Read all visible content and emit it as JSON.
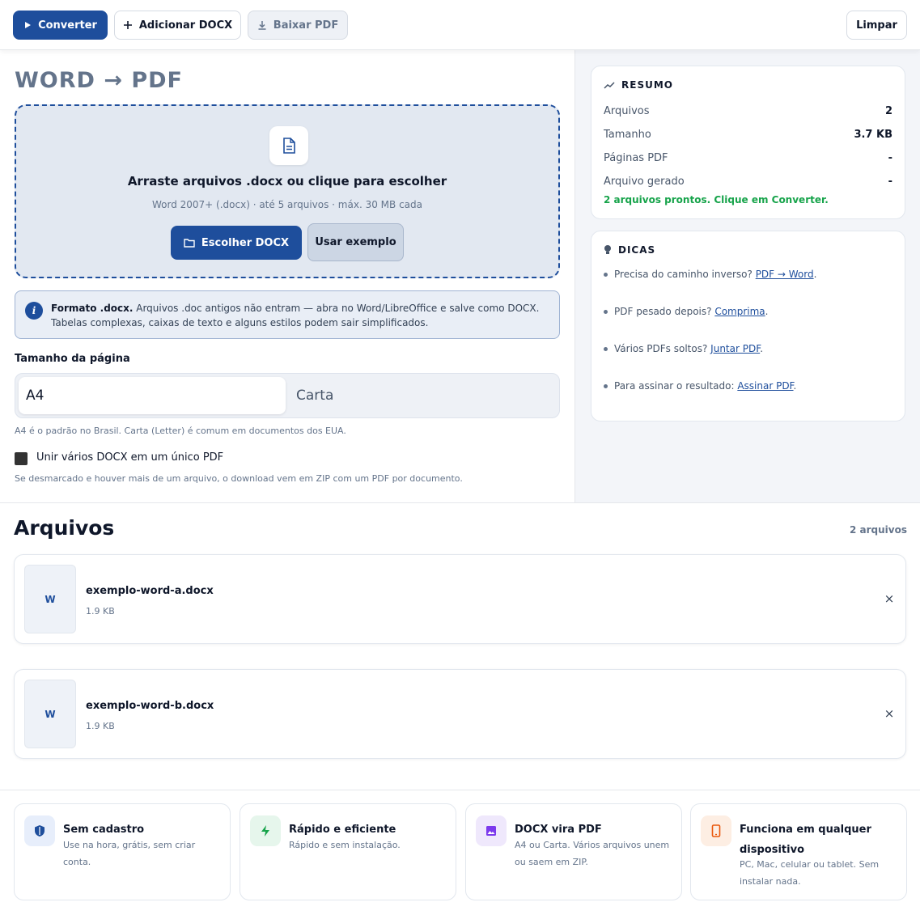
{
  "toolbar": {
    "convert_label": "Converter",
    "add_label": "Adicionar DOCX",
    "download_label": "Baixar PDF",
    "clear_label": "Limpar"
  },
  "page_title": "WORD → PDF",
  "dropzone": {
    "title": "Arraste arquivos .docx ou clique para escolher",
    "subtitle": "Word 2007+ (.docx) · até 5 arquivos · máx. 30 MB cada",
    "choose_label": "Escolher DOCX",
    "example_label": "Usar exemplo"
  },
  "info": {
    "bold": "Formato .docx.",
    "text": " Arquivos .doc antigos não entram — abra no Word/LibreOffice e salve como DOCX. Tabelas complexas, caixas de texto e alguns estilos podem sair simplificados."
  },
  "page_size": {
    "label": "Tamanho da página",
    "options": [
      "A4",
      "Carta"
    ],
    "selected": "A4",
    "hint": "A4 é o padrão no Brasil. Carta (Letter) é comum em documentos dos EUA."
  },
  "merge": {
    "label": "Unir vários DOCX em um único PDF",
    "checked": true,
    "hint": "Se desmarcado e houver mais de um arquivo, o download vem em ZIP com um PDF por documento."
  },
  "resumo": {
    "heading": "RESUMO",
    "rows": [
      {
        "key": "Arquivos",
        "value": "2"
      },
      {
        "key": "Tamanho",
        "value": "3.7 KB"
      },
      {
        "key": "Páginas PDF",
        "value": "-"
      },
      {
        "key": "Arquivo gerado",
        "value": "-"
      }
    ],
    "status": "2 arquivos prontos. Clique em Converter.",
    "status_color": "#16a34a"
  },
  "dicas": {
    "heading": "DICAS",
    "items": [
      {
        "text": "Precisa do caminho inverso? ",
        "link": "PDF → Word",
        "end": "."
      },
      {
        "text": "PDF pesado depois? ",
        "link": "Comprima",
        "end": "."
      },
      {
        "text": "Vários PDFs soltos? ",
        "link": "Juntar PDF",
        "end": "."
      },
      {
        "text": "Para assinar o resultado: ",
        "link": "Assinar PDF",
        "end": "."
      }
    ]
  },
  "arquivos": {
    "title": "Arquivos",
    "count": "2 arquivos",
    "files": [
      {
        "thumb": "W",
        "name": "exemplo-word-a.docx",
        "size": "1.9 KB",
        "remove": "×"
      },
      {
        "thumb": "W",
        "name": "exemplo-word-b.docx",
        "size": "1.9 KB",
        "remove": "×"
      }
    ]
  },
  "features": [
    {
      "icon": "shield-icon",
      "title": "Sem cadastro",
      "desc": "Use na hora, grátis, sem criar conta.",
      "color": "#1e4e9c",
      "bg": "#e7eefb"
    },
    {
      "icon": "bolt-icon",
      "title": "Rápido e eficiente",
      "desc": "Rápido e sem instalação.",
      "color": "#16a34a",
      "bg": "#e6f6ec"
    },
    {
      "icon": "image-icon",
      "title": "DOCX vira PDF",
      "desc": "A4 ou Carta. Vários arquivos unem ou saem em ZIP.",
      "color": "#7c3aed",
      "bg": "#efe8fc"
    },
    {
      "icon": "phone-icon",
      "title": "Funciona em qualquer dispositivo",
      "desc": "PC, Mac, celular ou tablet. Sem instalar nada.",
      "color": "#ea580c",
      "bg": "#fdeee3"
    }
  ],
  "colors": {
    "accent": "#1e4e9c",
    "success": "#16a34a"
  }
}
